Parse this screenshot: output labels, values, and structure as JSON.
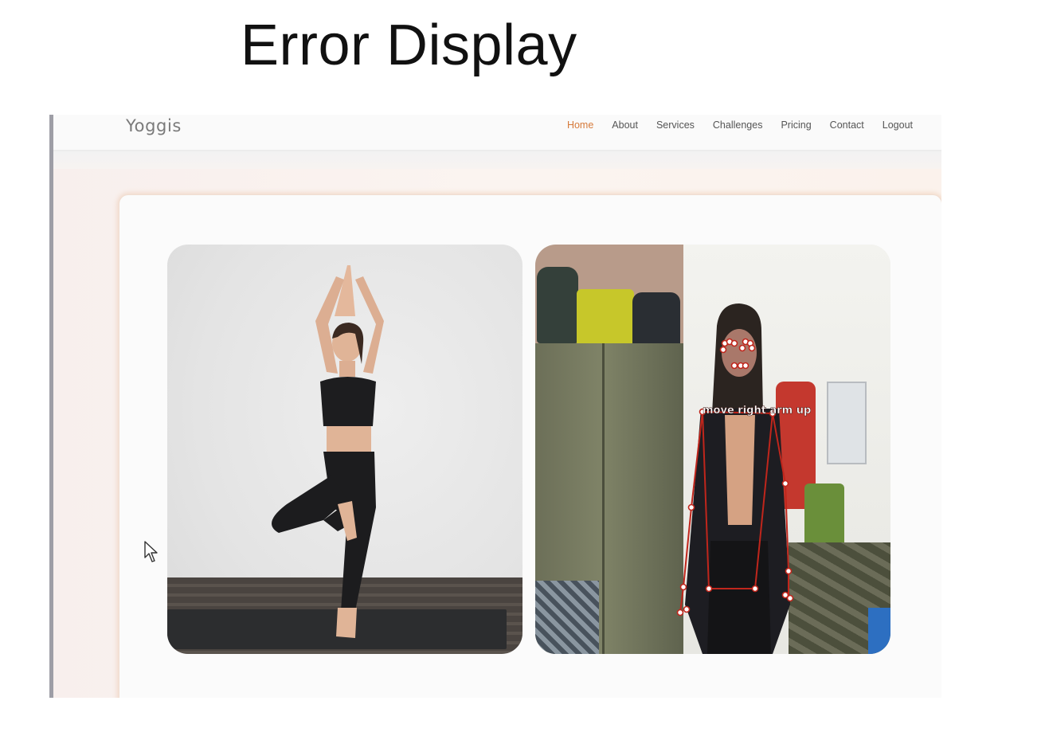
{
  "slide": {
    "title": "Error Display"
  },
  "site": {
    "brand": "Yoggis",
    "nav": [
      {
        "label": "Home",
        "active": true
      },
      {
        "label": "About",
        "active": false
      },
      {
        "label": "Services",
        "active": false
      },
      {
        "label": "Challenges",
        "active": false
      },
      {
        "label": "Pricing",
        "active": false
      },
      {
        "label": "Contact",
        "active": false
      },
      {
        "label": "Logout",
        "active": false
      }
    ],
    "active_color": "#d67a3a"
  },
  "main": {
    "reference_image": "tree-pose-reference-photo",
    "webcam_image": "webcam-pose-detection-feed",
    "feedback_text": "move right arm up",
    "skeleton_color": "#c0261c"
  }
}
